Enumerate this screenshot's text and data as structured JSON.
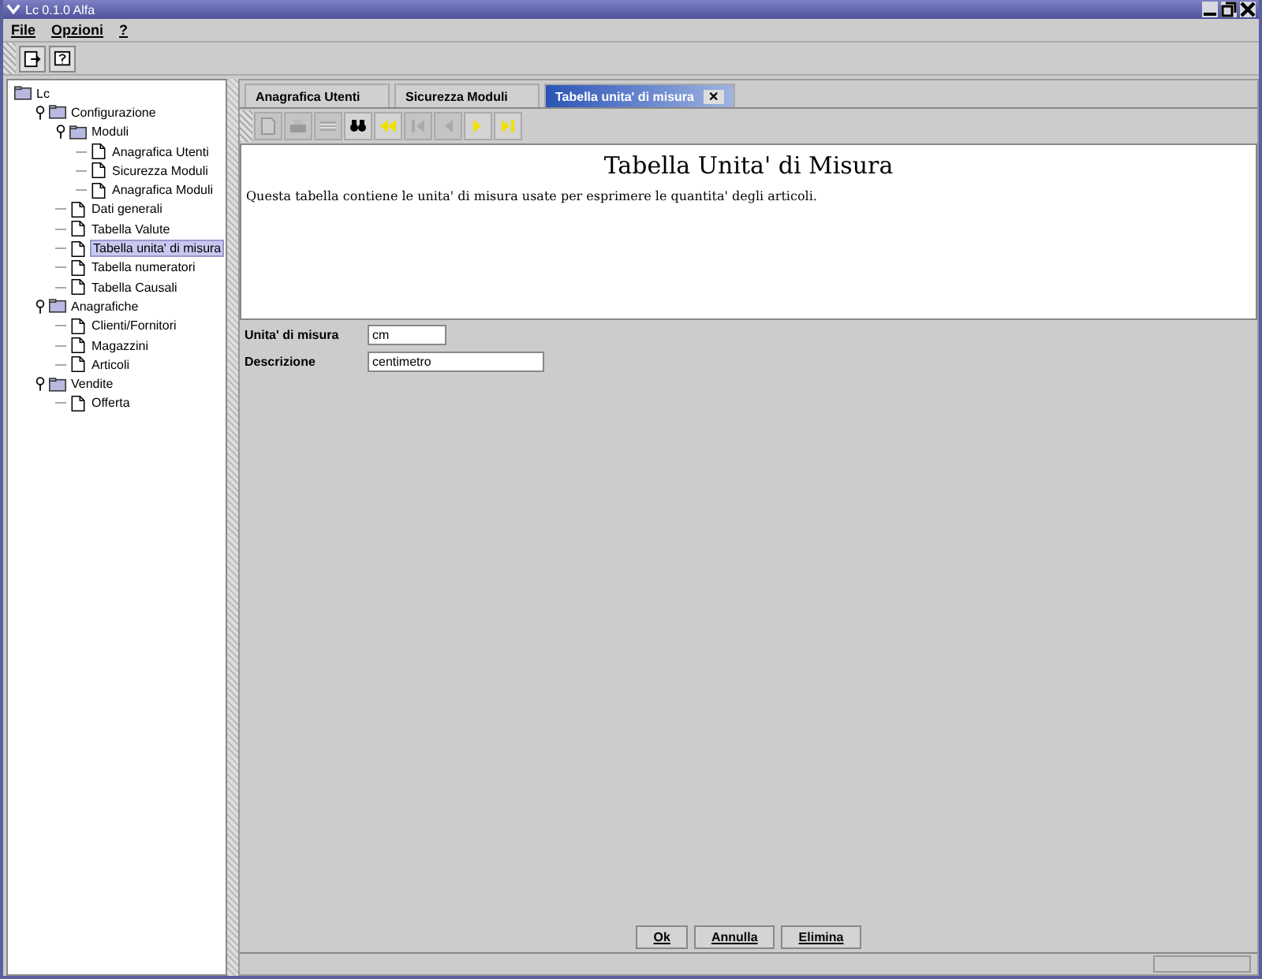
{
  "window": {
    "title": "Lc 0.1.0 Alfa"
  },
  "menu": [
    {
      "label": "File"
    },
    {
      "label": "Opzioni"
    },
    {
      "label": "?"
    }
  ],
  "main_toolbar": [
    {
      "kind": "exit"
    },
    {
      "kind": "help"
    }
  ],
  "tree": [
    {
      "label": "Lc",
      "kind": "folder",
      "selected": false,
      "children": [
        {
          "label": "Configurazione",
          "kind": "folder",
          "selected": false,
          "expanded": true,
          "children": [
            {
              "label": "Moduli",
              "kind": "folder",
              "selected": false,
              "expanded": true,
              "children": [
                {
                  "label": "Anagrafica Utenti",
                  "kind": "document",
                  "selected": false
                },
                {
                  "label": "Sicurezza Moduli",
                  "kind": "document",
                  "selected": false
                },
                {
                  "label": "Anagrafica Moduli",
                  "kind": "document",
                  "selected": false
                }
              ]
            },
            {
              "label": "Dati generali",
              "kind": "document",
              "selected": false
            },
            {
              "label": "Tabella Valute",
              "kind": "document",
              "selected": false
            },
            {
              "label": "Tabella unita' di misura",
              "kind": "document",
              "selected": true
            },
            {
              "label": "Tabella numeratori",
              "kind": "document",
              "selected": false
            },
            {
              "label": "Tabella Causali",
              "kind": "document",
              "selected": false
            }
          ]
        },
        {
          "label": "Anagrafiche",
          "kind": "folder",
          "selected": false,
          "expanded": true,
          "children": [
            {
              "label": "Clienti/Fornitori",
              "kind": "document",
              "selected": false
            },
            {
              "label": "Magazzini",
              "kind": "document",
              "selected": false
            },
            {
              "label": "Articoli",
              "kind": "document",
              "selected": false
            }
          ]
        },
        {
          "label": "Vendite",
          "kind": "folder",
          "selected": false,
          "expanded": true,
          "children": [
            {
              "label": "Offerta",
              "kind": "document",
              "selected": false
            }
          ]
        }
      ]
    }
  ],
  "tabs": [
    {
      "label": "Anagrafica Utenti",
      "selected": false
    },
    {
      "label": "Sicurezza Moduli",
      "selected": false
    },
    {
      "label": "Tabella unita' di misura",
      "selected": true,
      "close": "✕"
    }
  ],
  "record_toolbar": [
    {
      "kind": "new",
      "disabled": true
    },
    {
      "kind": "print",
      "disabled": true
    },
    {
      "kind": "grid",
      "disabled": true
    },
    {
      "kind": "search",
      "disabled": false
    },
    {
      "kind": "first",
      "disabled": false
    },
    {
      "kind": "prev-page",
      "disabled": true
    },
    {
      "kind": "prev",
      "disabled": true
    },
    {
      "kind": "next",
      "disabled": false
    },
    {
      "kind": "last",
      "disabled": false
    }
  ],
  "header": {
    "title": "Tabella Unita' di Misura",
    "description": "Questa tabella contiene le unita' di misura usate per esprimere le quantita' degli articoli."
  },
  "form": [
    {
      "label": "Unita' di misura",
      "value": "cm"
    },
    {
      "label": "Descrizione",
      "value": "centimetro"
    }
  ],
  "buttons": [
    {
      "label": "Ok"
    },
    {
      "label": "Annulla"
    },
    {
      "label": "Elimina"
    }
  ]
}
